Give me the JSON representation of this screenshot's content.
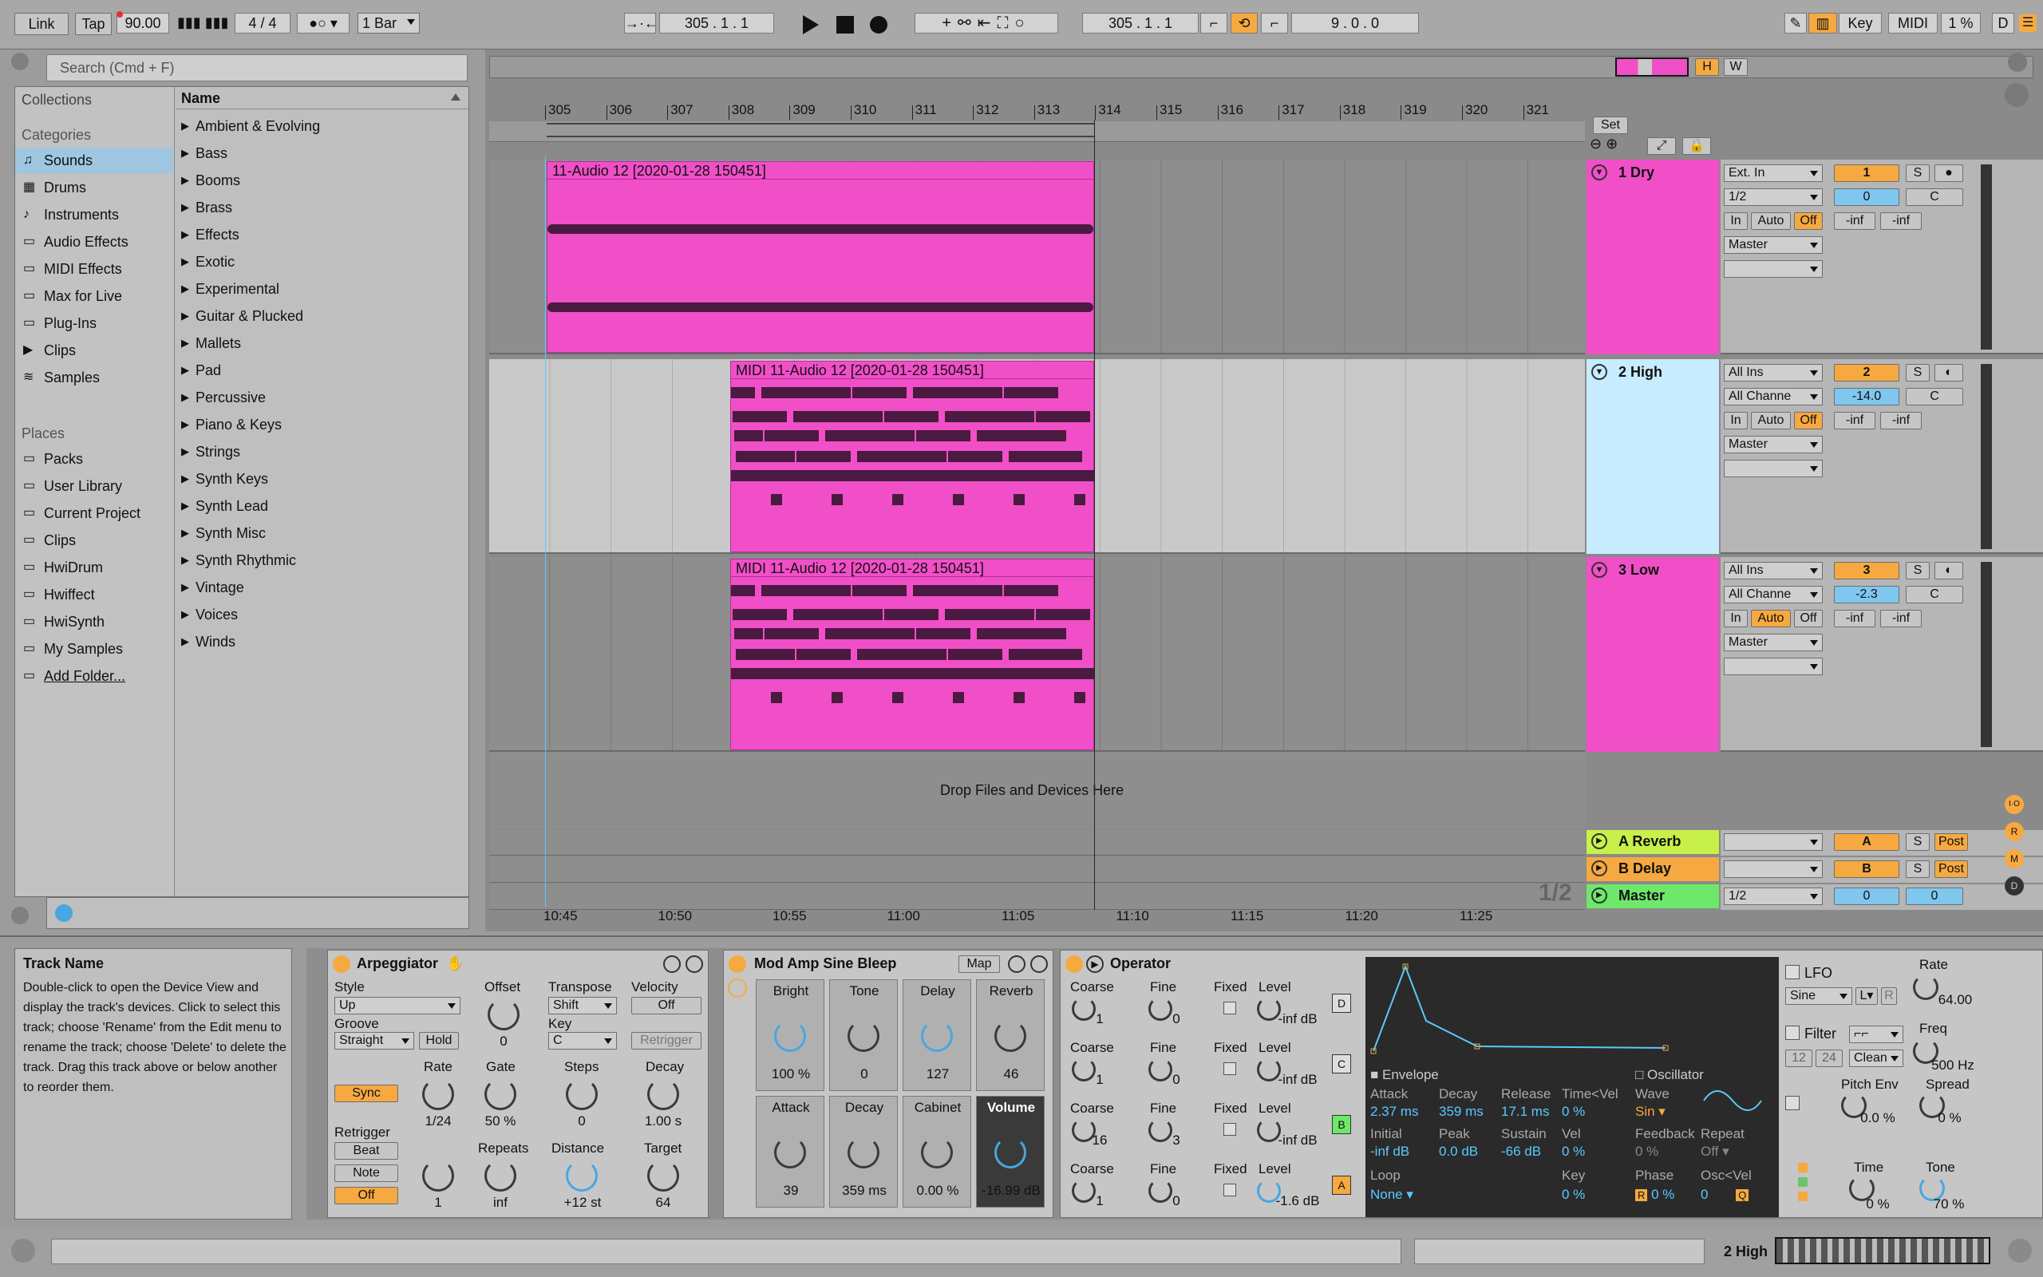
{
  "transport": {
    "link": "Link",
    "tap": "Tap",
    "tempo": "90.00",
    "time_sig_num": "4",
    "time_sig_sep": "/",
    "time_sig_den": "4",
    "quant": "1 Bar",
    "position": "305 .  1 .  1",
    "loop_start": "305 .  1 .  1",
    "loop_length": "9 .  0 .  0",
    "key_label": "Key",
    "midi_label": "MIDI",
    "cpu": "1 %",
    "d_label": "D"
  },
  "browser": {
    "search_placeholder": "Search (Cmd + F)",
    "collections": "Collections",
    "categories_header": "Categories",
    "categories": [
      "Sounds",
      "Drums",
      "Instruments",
      "Audio Effects",
      "MIDI Effects",
      "Max for Live",
      "Plug-Ins",
      "Clips",
      "Samples"
    ],
    "places_header": "Places",
    "places": [
      "Packs",
      "User Library",
      "Current Project",
      "Clips",
      "HwiDrum",
      "Hwiffect",
      "HwiSynth",
      "My Samples",
      "Add Folder..."
    ],
    "name_header": "Name",
    "items": [
      "Ambient & Evolving",
      "Bass",
      "Booms",
      "Brass",
      "Effects",
      "Exotic",
      "Experimental",
      "Guitar & Plucked",
      "Mallets",
      "Pad",
      "Percussive",
      "Piano & Keys",
      "Strings",
      "Synth Keys",
      "Synth Lead",
      "Synth Misc",
      "Synth Rhythmic",
      "Vintage",
      "Voices",
      "Winds"
    ]
  },
  "ruler": {
    "bars": [
      "305",
      "306",
      "307",
      "308",
      "309",
      "310",
      "311",
      "312",
      "313",
      "314",
      "315",
      "316",
      "317",
      "318",
      "319",
      "320",
      "321"
    ],
    "times": [
      "10:45",
      "10:50",
      "10:55",
      "11:00",
      "11:05",
      "11:10",
      "11:15",
      "11:20",
      "11:25"
    ]
  },
  "set_label": "Set",
  "tracks": [
    {
      "name": "1 Dry",
      "clip": "11-Audio 12 [2020-01-28 150451]",
      "input": "Ext. In",
      "channel": "1/2",
      "num": "1",
      "vol": "0",
      "pan": "C",
      "in": "In",
      "auto": "Auto",
      "off": "Off",
      "out": "Master",
      "meter_l": "-inf",
      "meter_r": "-inf",
      "s": "S"
    },
    {
      "name": "2 High",
      "clip": "MIDI 11-Audio 12 [2020-01-28 150451]",
      "input": "All Ins",
      "channel": "All Channe",
      "num": "2",
      "vol": "-14.0",
      "pan": "C",
      "in": "In",
      "auto": "Auto",
      "off": "Off",
      "out": "Master",
      "meter_l": "-inf",
      "meter_r": "-inf",
      "s": "S"
    },
    {
      "name": "3 Low",
      "clip": "MIDI 11-Audio 12 [2020-01-28 150451]",
      "input": "All Ins",
      "channel": "All Channe",
      "num": "3",
      "vol": "-2.3",
      "pan": "C",
      "in": "In",
      "auto": "Auto",
      "off": "Off",
      "out": "Master",
      "meter_l": "-inf",
      "meter_r": "-inf",
      "s": "S"
    }
  ],
  "drop_text": "Drop Files and Devices Here",
  "returns": [
    {
      "name": "A Reverb",
      "letter": "A",
      "s": "S",
      "post": "Post"
    },
    {
      "name": "B Delay",
      "letter": "B",
      "s": "S",
      "post": "Post"
    },
    {
      "name": "Master",
      "channel": "1/2",
      "vol": "0",
      "pan": "0"
    }
  ],
  "page_indicator": "1/2",
  "info": {
    "title": "Track Name",
    "body": "Double-click to open the Device View and display the track's devices. Click to select this track; choose 'Rename' from the Edit menu to rename the track; choose 'Delete' to delete the track. Drag this track above or below another to reorder them."
  },
  "arp": {
    "title": "Arpeggiator",
    "style_label": "Style",
    "style": "Up",
    "groove_label": "Groove",
    "groove": "Straight",
    "hold": "Hold",
    "offset_label": "Offset",
    "offset": "0",
    "transpose_label": "Transpose",
    "transpose": "Shift",
    "key_label": "Key",
    "key": "C",
    "velocity_label": "Velocity",
    "velocity": "Off",
    "retrigger_btn": "Retrigger",
    "sync": "Sync",
    "rate_label": "Rate",
    "rate": "1/24",
    "gate_label": "Gate",
    "gate": "50 %",
    "steps_label": "Steps",
    "steps": "0",
    "decay_label": "Decay",
    "decay": "1.00 s",
    "retrigger_label": "Retrigger",
    "beat": "Beat",
    "note": "Note",
    "off": "Off",
    "r_val": "1",
    "repeats_label": "Repeats",
    "repeats": "inf",
    "distance_label": "Distance",
    "distance": "+12 st",
    "target_label": "Target",
    "target": "64"
  },
  "rack": {
    "title": "Mod Amp Sine Bleep",
    "map": "Map",
    "macros": [
      {
        "label": "Bright",
        "value": "100 %"
      },
      {
        "label": "Tone",
        "value": "0"
      },
      {
        "label": "Delay",
        "value": "127"
      },
      {
        "label": "Reverb",
        "value": "46"
      },
      {
        "label": "Attack",
        "value": "39"
      },
      {
        "label": "Decay",
        "value": "359 ms"
      },
      {
        "label": "Cabinet",
        "value": "0.00 %"
      },
      {
        "label": "Volume",
        "value": "-16.99 dB"
      }
    ]
  },
  "operator": {
    "title": "Operator",
    "ops": [
      {
        "coarse": "1",
        "fine": "0",
        "level": "-inf dB",
        "letter": "D"
      },
      {
        "coarse": "1",
        "fine": "0",
        "level": "-inf dB",
        "letter": "C"
      },
      {
        "coarse": "16",
        "fine": "3",
        "level": "-inf dB",
        "letter": "B"
      },
      {
        "coarse": "1",
        "fine": "0",
        "level": "-1.6 dB",
        "letter": "A"
      }
    ],
    "coarse_label": "Coarse",
    "fine_label": "Fine",
    "fixed_label": "Fixed",
    "level_label": "Level",
    "envelope": "Envelope",
    "oscillator": "Oscillator",
    "attack_label": "Attack",
    "attack": "2.37 ms",
    "decay_label": "Decay",
    "decay": "359 ms",
    "release_label": "Release",
    "release": "17.1 ms",
    "timevel_label": "Time<Vel",
    "timevel": "0 %",
    "initial_label": "Initial",
    "initial": "-inf dB",
    "peak_label": "Peak",
    "peak": "0.0 dB",
    "sustain_label": "Sustain",
    "sustain": "-66 dB",
    "vel_label": "Vel",
    "vel": "0 %",
    "loop_label": "Loop",
    "loop": "None",
    "key_label": "Key",
    "key": "0 %",
    "wave_label": "Wave",
    "wave": "Sin",
    "feedback_label": "Feedback",
    "feedback": "0 %",
    "repeat_label": "Repeat",
    "repeat": "Off",
    "phase_label": "Phase",
    "phase": "0 %",
    "oscvel_label": "Osc<Vel",
    "oscvel": "0"
  },
  "lfo": {
    "lfo_label": "LFO",
    "wave": "Sine",
    "rate_label": "Rate",
    "rate": "64.00",
    "filter_label": "Filter",
    "filter_mode": "Clean",
    "freq_label": "Freq",
    "freq": "500 Hz",
    "n12": "12",
    "n24": "24",
    "pitch_env_label": "Pitch Env",
    "pitch_env": "0.0 %",
    "spread_label": "Spread",
    "spread": "0 %",
    "time_label": "Time",
    "time": "0 %",
    "tone_label": "Tone",
    "tone": "70 %"
  },
  "status": {
    "track": "2 High"
  }
}
